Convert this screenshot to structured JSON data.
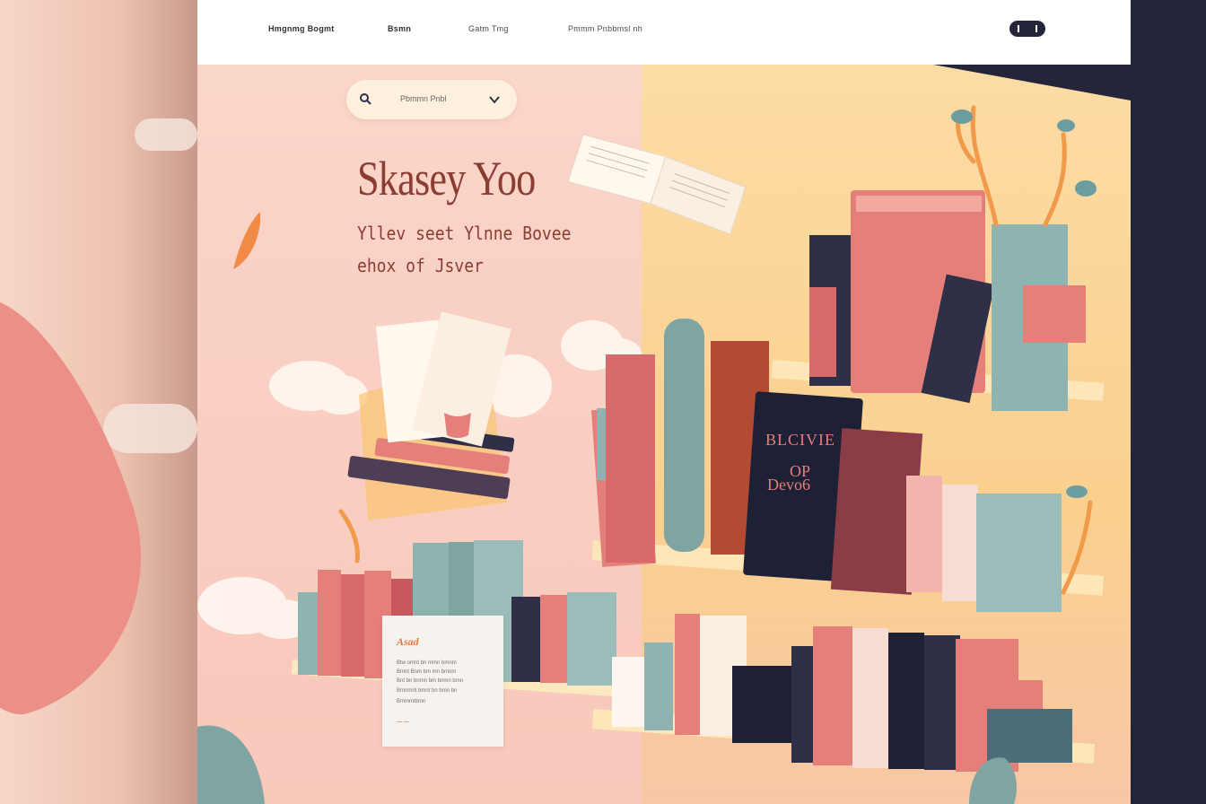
{
  "nav": {
    "items": [
      "Hmgnmg Bogmt",
      "Bsmn",
      "Gatm Tmg",
      "Pmmm Pnbbmsl nh"
    ],
    "toggle_icon": "toggle-icon"
  },
  "search": {
    "text": "Pbmmn Pnbl",
    "icon": "search-icon",
    "chevron": "chevron-down-icon"
  },
  "hero": {
    "title": "Skasey Yoo",
    "subtitle_line1": "Yllev seet Ylnne Bovee",
    "subtitle_line2": "ehox of Jsver"
  },
  "book_spines": {
    "center_book_line1": "BLCIVIE",
    "center_book_line2": "OP",
    "center_book_line3": "Devo6"
  },
  "card": {
    "title": "Asad",
    "lines": [
      "Btw omnt  bn mmn  bmnm",
      "Bmnt Bnm  bm mn  bmnm",
      "Bnt bn bnmn  bm bnmn bmn",
      "Bmnmnt bmnt bn bmn bn"
    ],
    "more": "Bmmmtbmn",
    "link": "— —"
  },
  "colors": {
    "accent": "#8a3d33",
    "dark": "#23253a",
    "pink": "#e57f7a",
    "teal": "#8fb3b0",
    "yellow": "#fbd49b",
    "orange": "#f09a4a"
  }
}
